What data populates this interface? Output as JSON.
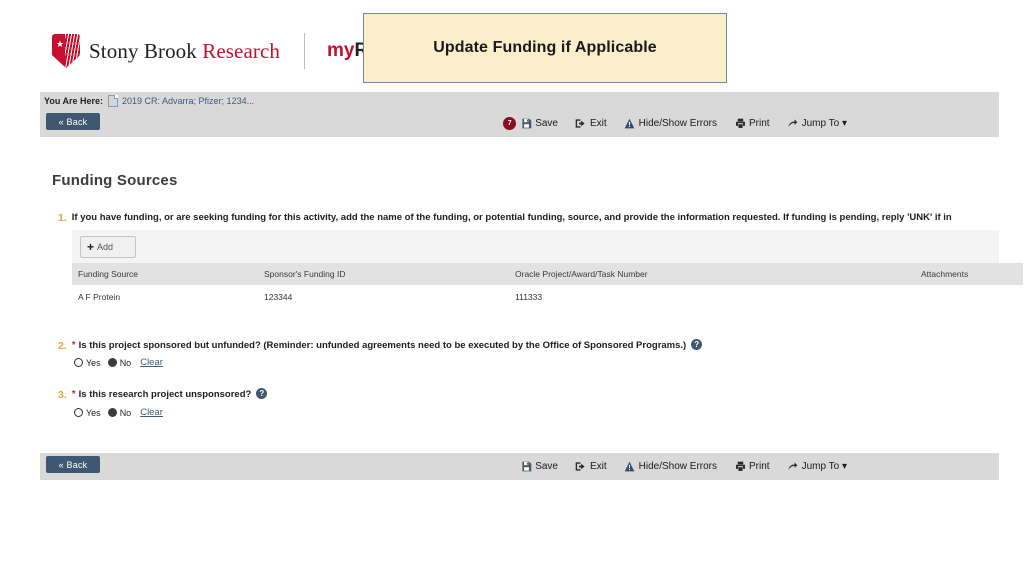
{
  "header": {
    "logo": {
      "shield_icon": "stony-brook-shield-icon",
      "text_primary": "Stony Brook ",
      "text_accent": "Research",
      "product_prefix": "my",
      "product_name": "RESEARCH"
    },
    "colors": {
      "brand_red": "#c8102e",
      "toolbar_gray": "#d9d9d9",
      "button_slate": "#3f5871",
      "callout_bg": "#fbeecb",
      "callout_border": "#6b88a6",
      "link_blue": "#3c5a7a",
      "number_orange": "#e8a33d",
      "required_red": "#c0392b",
      "error_badge_red": "#8b0d22"
    }
  },
  "callout": {
    "text": "Update Funding if Applicable"
  },
  "breadcrumb": {
    "label": "You Are Here:",
    "doc_icon": "document-icon",
    "link": "2019 CR: Advarra; Pfizer; 1234..."
  },
  "toolbar_top": {
    "back_label": "« Back",
    "error_count": "7",
    "items": [
      {
        "icon": "save-icon",
        "label": "Save"
      },
      {
        "icon": "exit-icon",
        "label": "Exit"
      },
      {
        "icon": "warning-icon",
        "label": "Hide/Show Errors"
      },
      {
        "icon": "printer-icon",
        "label": "Print"
      },
      {
        "icon": "jump-arrow-icon",
        "label": "Jump To ▾"
      }
    ]
  },
  "toolbar_bottom": {
    "back_label": "« Back",
    "items": [
      {
        "icon": "save-icon",
        "label": "Save"
      },
      {
        "icon": "exit-icon",
        "label": "Exit"
      },
      {
        "icon": "warning-icon",
        "label": "Hide/Show Errors"
      },
      {
        "icon": "printer-icon",
        "label": "Print"
      },
      {
        "icon": "jump-arrow-icon",
        "label": "Jump To ▾"
      }
    ]
  },
  "page": {
    "title": "Funding Sources",
    "questions": [
      {
        "number": "1.",
        "required": false,
        "text": "If you have funding, or are seeking funding for this activity, add the name of the funding, or potential funding, source, and provide the information requested.  If funding is pending, reply 'UNK' if in",
        "help": false
      },
      {
        "number": "2.",
        "required": true,
        "text": "Is this project sponsored but unfunded? (Reminder: unfunded agreements need to be executed by the Office of Sponsored Programs.)",
        "help": true,
        "help_icon": "help-question-icon",
        "options": [
          {
            "label": "Yes",
            "selected": false
          },
          {
            "label": "No",
            "selected": true
          }
        ],
        "clear_label": "Clear"
      },
      {
        "number": "3.",
        "required": true,
        "text": "Is this research project unsponsored?",
        "help": true,
        "help_icon": "help-question-icon",
        "options": [
          {
            "label": "Yes",
            "selected": false
          },
          {
            "label": "No",
            "selected": true
          }
        ],
        "clear_label": "Clear"
      }
    ],
    "add_button": {
      "icon": "plus-icon",
      "label": "Add"
    },
    "table": {
      "columns": [
        "Funding Source",
        "Sponsor's Funding ID",
        "Oracle Project/Award/Task Number",
        "Attachments"
      ],
      "rows": [
        {
          "funding_source": "A F Protein",
          "sponsor_funding_id": "123344",
          "oracle_number": "111333",
          "attachments": ""
        }
      ]
    }
  }
}
